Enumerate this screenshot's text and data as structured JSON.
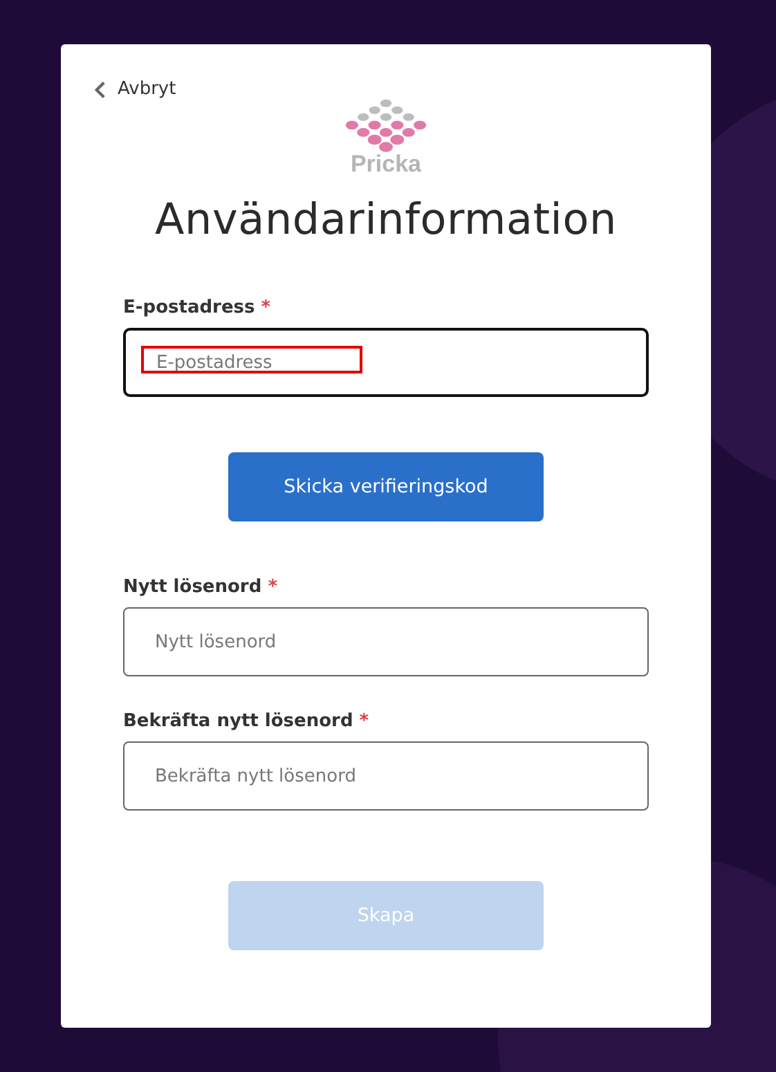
{
  "back_link": {
    "label": "Avbryt"
  },
  "logo": {
    "text": "Pricka"
  },
  "title": "Användarinformation",
  "sections": [
    {
      "kind": "field",
      "label": "E-postadress",
      "required_mark": "*",
      "placeholder": "E-postadress",
      "focused": true,
      "highlighted": true
    },
    {
      "kind": "button",
      "label": "Skicka verifieringskod",
      "disabled": false
    },
    {
      "kind": "field",
      "label": "Nytt lösenord",
      "required_mark": "*",
      "placeholder": "Nytt lösenord",
      "focused": false,
      "highlighted": false
    },
    {
      "kind": "field",
      "label": "Bekräfta nytt lösenord",
      "required_mark": "*",
      "placeholder": "Bekräfta nytt lösenord",
      "focused": false,
      "highlighted": false
    },
    {
      "kind": "button",
      "label": "Skapa",
      "disabled": true
    }
  ]
}
